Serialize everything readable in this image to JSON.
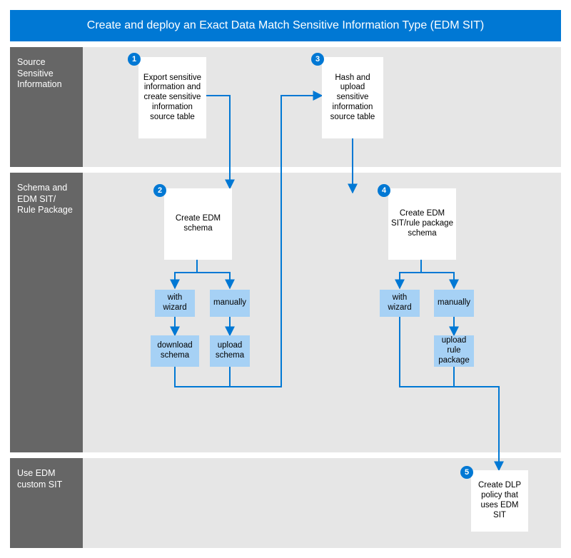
{
  "title": "Create and deploy an Exact Data Match Sensitive Information Type (EDM SIT)",
  "bands": {
    "b1": "Source Sensitive Information",
    "b2": "Schema and EDM SIT/ Rule Package",
    "b3": "Use EDM custom SIT"
  },
  "nodes": {
    "n1": "Export sensitive information and create sensitive information source table",
    "n2": "Create EDM schema",
    "n3": "Hash and upload sensitive information source table",
    "n4": "Create EDM SIT/rule package schema",
    "n2a": "with wizard",
    "n2b": "manually",
    "n2c": "download schema",
    "n2d": "upload schema",
    "n4a": "with wizard",
    "n4b": "manually",
    "n4d": "upload rule package",
    "n5": "Create DLP policy that uses EDM SIT"
  },
  "badges": {
    "b1": "1",
    "b2": "2",
    "b3": "3",
    "b4": "4",
    "b5": "5"
  },
  "colors": {
    "brand": "#0078d4",
    "arrow": "#0078d4"
  }
}
